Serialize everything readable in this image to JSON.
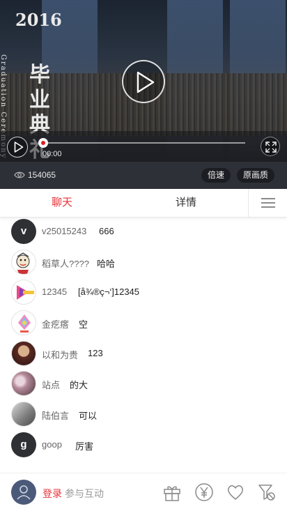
{
  "video": {
    "title_year": "2016",
    "title_en": "Graduation Ceremony",
    "title_cn": "毕业典礼",
    "time": "00:00",
    "progress": 0.0
  },
  "info": {
    "views": "154065",
    "speed_label": "倍速",
    "quality_label": "原画质"
  },
  "tabs": {
    "chat": "聊天",
    "detail": "详情"
  },
  "messages": [
    {
      "avatar_letter": "v",
      "user": "v25015243",
      "text": "666",
      "avatar_type": "letter"
    },
    {
      "avatar_letter": "",
      "user": "稻草人????",
      "text": "哈哈",
      "avatar_type": "cartoon"
    },
    {
      "avatar_letter": "",
      "user": "12345",
      "text": "[å¾®ç¬‘]12345",
      "avatar_type": "logo"
    },
    {
      "avatar_letter": "",
      "user": "金疙瘩",
      "text": "空",
      "avatar_type": "kuaishou"
    },
    {
      "avatar_letter": "",
      "user": "以和为贵",
      "text": "123",
      "avatar_type": "photo-man"
    },
    {
      "avatar_letter": "",
      "user": "站点",
      "text": "的大",
      "avatar_type": "photo-flowers"
    },
    {
      "avatar_letter": "",
      "user": "陆伯言",
      "text": "可以",
      "avatar_type": "photo-gray"
    },
    {
      "avatar_letter": "g",
      "user": "goop",
      "text": "厉害",
      "avatar_type": "letter"
    }
  ],
  "bottom": {
    "login": "登录",
    "join": "参与互动"
  },
  "colors": {
    "accent": "#e8333a",
    "info_bar": "#2e3038"
  }
}
